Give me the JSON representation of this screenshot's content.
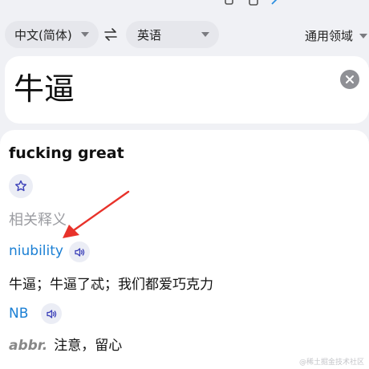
{
  "toolbar": {
    "source_language": "中文(简体)",
    "target_language": "英语",
    "domain": "通用领域"
  },
  "input": {
    "text": "牛逼"
  },
  "result": {
    "translation": "fucking great",
    "related_title": "相关释义",
    "entries": [
      {
        "word": "niubility",
        "definition": "牛逼；牛逼了忒；我们都爱巧克力"
      },
      {
        "word": "NB",
        "pos": "abbr.",
        "definition": "注意，留心"
      }
    ]
  },
  "watermark": "@稀土掘金技术社区",
  "colors": {
    "background": "#f0f1f5",
    "card": "#ffffff",
    "link_blue": "#1a7fd4",
    "annotation_red": "#e8322a"
  },
  "icons": [
    "swap-icon",
    "chevron-down-icon",
    "clear-icon",
    "star-icon",
    "speaker-icon"
  ]
}
